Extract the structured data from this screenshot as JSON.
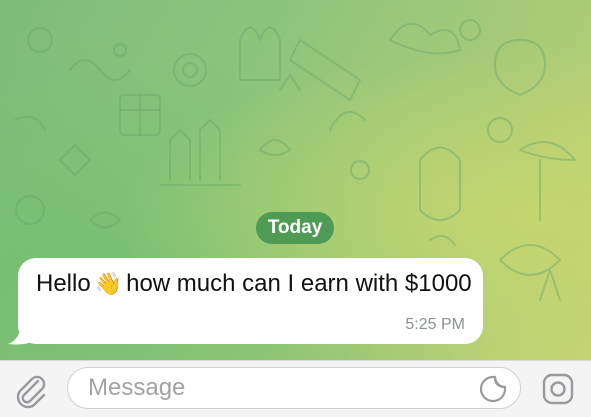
{
  "chat": {
    "date_separator": "Today",
    "message": {
      "text_before": "Hello",
      "emoji": "👋",
      "text_after": "how much can I earn with $1000",
      "time": "5:25 PM"
    }
  },
  "composer": {
    "placeholder": "Message",
    "value": ""
  },
  "icons": {
    "attach": "paperclip-icon",
    "sticker": "sticker-icon",
    "camera": "camera-icon"
  },
  "colors": {
    "wallpaper_start": "#7dbd7a",
    "wallpaper_end": "#c6d474",
    "date_pill": "#4f9a55",
    "bubble": "#ffffff",
    "timestamp": "#8c9295",
    "icon_gray": "#9a9a9e"
  }
}
